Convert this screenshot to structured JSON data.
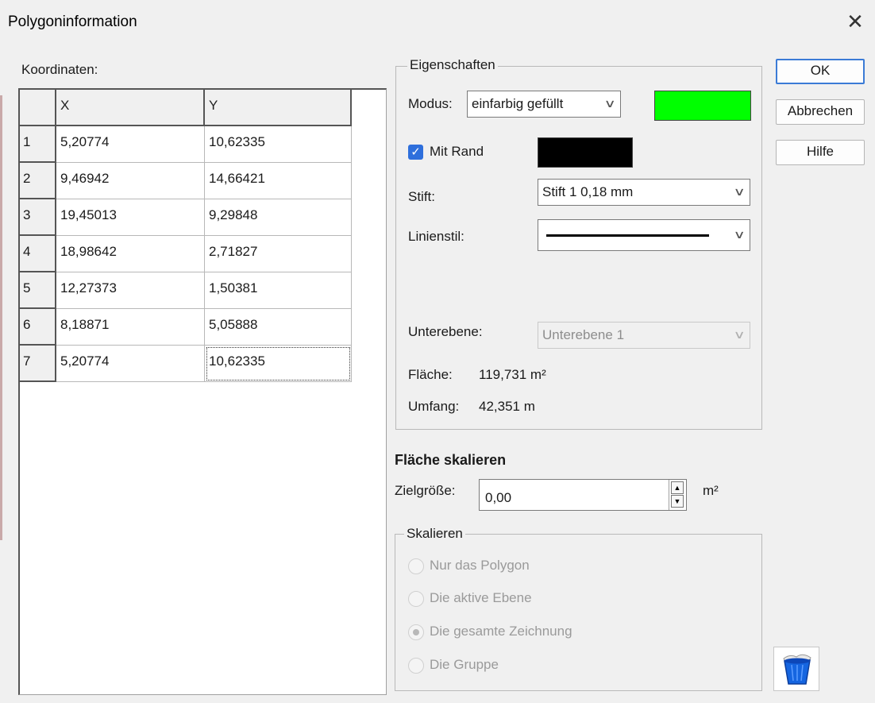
{
  "window": {
    "title": "Polygoninformation"
  },
  "coords": {
    "label": "Koordinaten:",
    "headers": [
      "X",
      "Y"
    ],
    "rows": [
      {
        "n": "1",
        "x": "5,20774",
        "y": "10,62335"
      },
      {
        "n": "2",
        "x": "9,46942",
        "y": "14,66421"
      },
      {
        "n": "3",
        "x": "19,45013",
        "y": "9,29848"
      },
      {
        "n": "4",
        "x": "18,98642",
        "y": "2,71827"
      },
      {
        "n": "5",
        "x": "12,27373",
        "y": "1,50381"
      },
      {
        "n": "6",
        "x": "8,18871",
        "y": "5,05888"
      },
      {
        "n": "7",
        "x": "5,20774",
        "y": "10,62335"
      }
    ]
  },
  "props": {
    "group_title": "Eigenschaften",
    "mode_label": "Modus:",
    "mode_value": "einfarbig gefüllt",
    "fill_color": "#00ff00",
    "border_checkbox_label": "Mit Rand",
    "border_checked": true,
    "border_color": "#000000",
    "pen_label": "Stift:",
    "pen_value": "Stift 1   0,18 mm",
    "linestyle_label": "Linienstil:",
    "sublayer_label": "Unterebene:",
    "sublayer_value": "Unterebene 1",
    "area_label": "Fläche:",
    "area_value": "119,731 m²",
    "perimeter_label": "Umfang:",
    "perimeter_value": "42,351 m"
  },
  "scale": {
    "heading": "Fläche skalieren",
    "target_label": "Zielgröße:",
    "target_value": "0,00",
    "unit": "m²",
    "group_title": "Skalieren",
    "options": [
      {
        "label": "Nur das Polygon",
        "selected": false
      },
      {
        "label": "Die aktive Ebene",
        "selected": false
      },
      {
        "label": "Die gesamte Zeichnung",
        "selected": true
      },
      {
        "label": "Die Gruppe",
        "selected": false
      }
    ]
  },
  "buttons": {
    "ok": "OK",
    "cancel": "Abbrechen",
    "help": "Hilfe"
  },
  "icons": {
    "close": "close-icon",
    "recycle": "recycle-bin-icon"
  },
  "colors": {
    "accent": "#2e6fdc"
  }
}
